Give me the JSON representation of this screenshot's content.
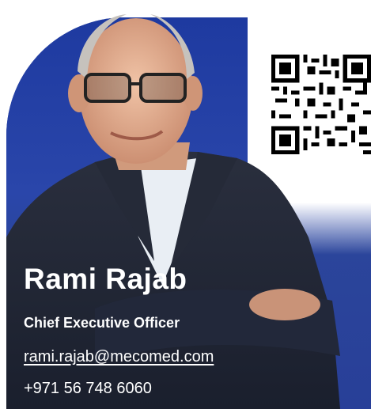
{
  "contact": {
    "name": "Rami Rajab",
    "title": "Chief Executive Officer",
    "email": "rami.rajab@mecomed.com",
    "phone": "+971 56 748 6060"
  },
  "icons": {
    "qr": "qr-code-icon"
  },
  "colors": {
    "card_blue": "#263c9a",
    "text": "#ffffff"
  }
}
